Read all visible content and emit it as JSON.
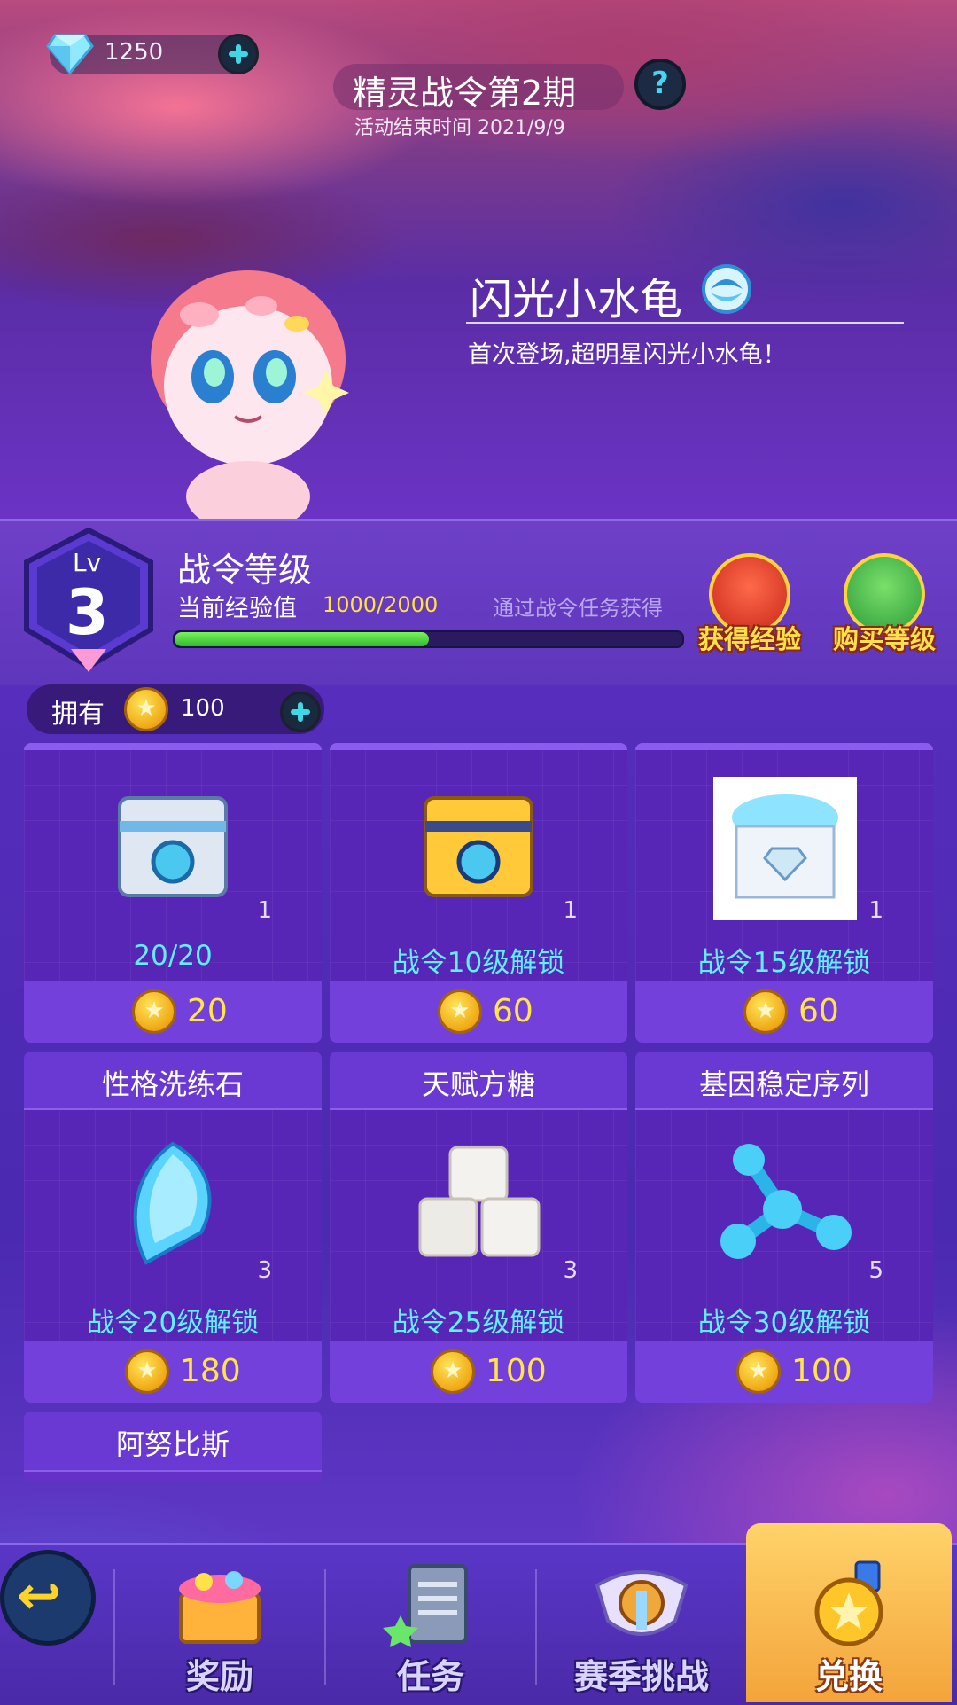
{
  "currency": {
    "gem_value": "1250",
    "gem_icon": "diamond-icon"
  },
  "header": {
    "title": "精灵战令第2期",
    "subtitle": "活动结束时间 2021/9/9",
    "help_label": "?"
  },
  "featured_pet": {
    "name": "闪光小水龟",
    "description": "首次登场,超明星闪光小水龟！",
    "element_icon": "water-element-icon"
  },
  "level": {
    "lv_label": "Lv",
    "lv_number": "3",
    "title": "战令等级",
    "exp_label": "当前经验值",
    "exp_value": "1000/2000",
    "exp_fraction": 0.5,
    "exp_hint": "通过战令任务获得",
    "get_exp_label": "获得经验",
    "buy_level_label": "购买等级"
  },
  "owned": {
    "label": "拥有",
    "value": "100"
  },
  "shop_items": [
    {
      "title": "",
      "quantity": "1",
      "unlock": "20/20",
      "price": "20",
      "icon": "silver-chest-icon"
    },
    {
      "title": "",
      "quantity": "1",
      "unlock": "战令10级解锁",
      "price": "60",
      "icon": "gold-chest-icon"
    },
    {
      "title": "",
      "quantity": "1",
      "unlock": "战令15级解锁",
      "price": "60",
      "icon": "diamond-box-icon"
    },
    {
      "title": "性格洗练石",
      "quantity": "3",
      "unlock": "战令20级解锁",
      "price": "180",
      "icon": "crystal-stone-icon"
    },
    {
      "title": "天赋方糖",
      "quantity": "3",
      "unlock": "战令25级解锁",
      "price": "100",
      "icon": "sugar-cube-icon"
    },
    {
      "title": "基因稳定序列",
      "quantity": "5",
      "unlock": "战令30级解锁",
      "price": "100",
      "icon": "gene-molecule-icon"
    },
    {
      "title": "阿努比斯"
    }
  ],
  "nav": {
    "back_label": "↩",
    "tabs": [
      {
        "label": "奖励",
        "icon": "reward-chest-icon"
      },
      {
        "label": "任务",
        "icon": "task-clipboard-icon"
      },
      {
        "label": "赛季挑战",
        "icon": "season-badge-icon"
      },
      {
        "label": "兑换",
        "icon": "exchange-coin-icon"
      }
    ]
  },
  "colors": {
    "accent_gold": "#ffe44a",
    "accent_cyan": "#5ff0ff",
    "panel_purple": "#6430c8"
  }
}
